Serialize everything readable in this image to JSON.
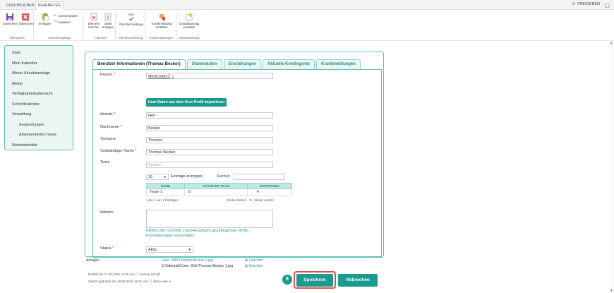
{
  "ribbon_tabs": [
    {
      "label": "DURCHSUCHEN"
    },
    {
      "label": "BEARBEITEN"
    }
  ],
  "share_label": "FREIGEBEN",
  "ribbon": {
    "groups": [
      {
        "label": "Übergeben",
        "buttons": [
          "Speichern",
          "Abbrechen"
        ]
      },
      {
        "label": "Zwischenablage",
        "buttons": [
          "Einfügen"
        ],
        "small": [
          "Ausschneiden",
          "Kopieren"
        ]
      },
      {
        "label": "Aktionen",
        "buttons": [
          "Element löschen",
          "Datei anfügen"
        ]
      },
      {
        "label": "Rechtschreibung",
        "buttons": [
          "Rechtschreibung"
        ],
        "abc": "ABC"
      },
      {
        "label": "Krankmeldungen",
        "buttons": [
          "Krankmeldung erstellen"
        ]
      },
      {
        "label": "Urlaubsanträge",
        "buttons": [
          "Urlaubsantrag erstellen"
        ]
      }
    ]
  },
  "nav": {
    "items": [
      {
        "label": "Start"
      },
      {
        "label": "Mein Kalender"
      },
      {
        "label": "Meine Urlaubsanträge"
      },
      {
        "label": "Meine"
      },
      {
        "label": "Verfügbarkeitsübersicht"
      },
      {
        "label": "Schichtkalender"
      },
      {
        "label": "Verwaltung"
      },
      {
        "label": "Auswertungen"
      },
      {
        "label": "Abwesenheiten heute"
      },
      {
        "label": "Websiteinhalte"
      }
    ]
  },
  "form_tabs": [
    {
      "label": "Benutzer Informationen (Thomas Becker)"
    },
    {
      "label": "Stammdaten"
    },
    {
      "label": "Einstellungen"
    },
    {
      "label": "Aktuelle Kontingente"
    },
    {
      "label": "Krankmeldungen"
    }
  ],
  "form": {
    "person_label": "Person",
    "person_value": "demo-user-1",
    "person_remove": "×",
    "import_button": "User-Daten aus dem User-Profil importieren",
    "anrede_label": "Anrede",
    "anrede_value": "Herr",
    "nachname_label": "Nachname",
    "nachname_value": "Becker",
    "vorname_label": "Vorname",
    "vorname_value": "Thomas",
    "vollname_label": "Vollständiger Name",
    "vollname_value": "Thomas Becker",
    "team_label": "Team",
    "team_placeholder": "Suchen",
    "required_mark": "*",
    "entries_value": "10",
    "entries_label": "Einträge anzeigen",
    "search_label": "Suchen",
    "grid_headers": [
      "NAME",
      "STANDARD TEAM",
      "ENTFERNEN"
    ],
    "grid_rows": [
      {
        "name": "Team 1",
        "standard": "☑",
        "remove": "✕"
      }
    ],
    "grid_info": "1 bis 1 von 1 Einträgen",
    "pager": {
      "first": "Erster",
      "prev": "Zurück",
      "page": "1",
      "next": "Weiter",
      "last": "Letzter"
    },
    "notes_label": "Notizen",
    "notes_help": "Klicken Sie, um Hilfe zum Hinzufügen grundlegender HTML-Formatierungen anzuzeigen.",
    "status_label": "Status",
    "status_value": "Aktiv"
  },
  "attachments": {
    "label": "Anlagen",
    "file_link": "User- Bild Thomas Becker 1.jpg",
    "file_path": "C:\\fakepath\\User- Bild Thomas Becker 1.jpg",
    "delete_1": "Löschen",
    "delete_2": "Löschen"
  },
  "meta": {
    "created": "Erstellt am 17.05.2016 15:50  von",
    "created_by": "Gunnar Schuff",
    "modified": "Zuletzt geändert am 19.05.2016 16:21  von",
    "modified_by": "demo-user-4"
  },
  "actions": {
    "step_badge": "8",
    "save": "Speichern",
    "cancel": "Abbrechen"
  },
  "colors": {
    "teal": "#1b9a8e",
    "highlight": "#d9534f"
  }
}
